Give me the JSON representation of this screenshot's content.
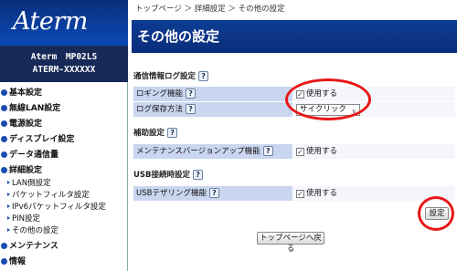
{
  "brand": {
    "logo": "Aterm",
    "model": "Aterm　MP02LS",
    "serial": "ATERM-XXXXXX"
  },
  "nav": {
    "items": [
      {
        "label": "基本設定"
      },
      {
        "label": "無線LAN設定"
      },
      {
        "label": "電源設定"
      },
      {
        "label": "ディスプレイ設定"
      },
      {
        "label": "データ通信量"
      },
      {
        "label": "詳細設定"
      }
    ],
    "sub_items": [
      {
        "label": "LAN側設定"
      },
      {
        "label": "パケットフィルタ設定"
      },
      {
        "label": "IPv6パケットフィルタ設定"
      },
      {
        "label": "PIN設定"
      },
      {
        "label": "その他の設定"
      }
    ],
    "maintenance": "メンテナンス",
    "info": "情報"
  },
  "breadcrumb": "トップページ ＞ 詳細設定 ＞ その他の設定",
  "page_title": "その他の設定",
  "help_icon": "?",
  "sections": {
    "comm_log": {
      "title": "通信情報ログ設定",
      "logging": {
        "label": "ロギング機能",
        "checkbox_label": "使用する",
        "checked": true
      },
      "save_method": {
        "label": "ログ保存方法",
        "selected": "サイクリック"
      }
    },
    "assist": {
      "title": "補助設定",
      "maint_update": {
        "label": "メンテナンスバージョンアップ機能",
        "checkbox_label": "使用する",
        "checked": true
      }
    },
    "usb": {
      "title": "USB接続時設定",
      "tethering": {
        "label": "USBテザリング機能",
        "checkbox_label": "使用する",
        "checked": true
      }
    }
  },
  "buttons": {
    "apply": "設定",
    "back_top": "トップページへ戻る"
  },
  "checkmark": "✓",
  "select_arrow": "∨",
  "colors": {
    "header_blue": "#0d3b94",
    "label_bg": "#cad6ef",
    "highlight_ring": "#e81717"
  }
}
